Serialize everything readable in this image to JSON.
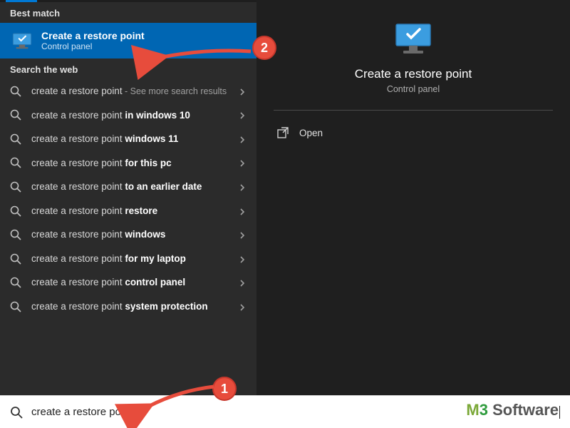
{
  "sections": {
    "best_match": "Best match",
    "web": "Search the web"
  },
  "best_match": {
    "title": "Create a restore point",
    "subtitle": "Control panel"
  },
  "web_results": [
    {
      "prefix": "create a restore point",
      "bold": "",
      "suffix": " - See more search results"
    },
    {
      "prefix": "create a restore point ",
      "bold": "in windows 10",
      "suffix": ""
    },
    {
      "prefix": "create a restore point ",
      "bold": "windows 11",
      "suffix": ""
    },
    {
      "prefix": "create a restore point ",
      "bold": "for this pc",
      "suffix": ""
    },
    {
      "prefix": "create a restore point ",
      "bold": "to an earlier date",
      "suffix": ""
    },
    {
      "prefix": "create a restore point ",
      "bold": "restore",
      "suffix": ""
    },
    {
      "prefix": "create a restore point ",
      "bold": "windows",
      "suffix": ""
    },
    {
      "prefix": "create a restore point ",
      "bold": "for my laptop",
      "suffix": ""
    },
    {
      "prefix": "create a restore point ",
      "bold": "control panel",
      "suffix": ""
    },
    {
      "prefix": "create a restore point ",
      "bold": "system protection",
      "suffix": ""
    }
  ],
  "preview": {
    "title": "Create a restore point",
    "subtitle": "Control panel",
    "actions": {
      "open": "Open"
    }
  },
  "search": {
    "query": "create a restore point"
  },
  "callouts": {
    "one": "1",
    "two": "2"
  },
  "brand": {
    "m": "M",
    "three": "3",
    "rest": " Software"
  }
}
